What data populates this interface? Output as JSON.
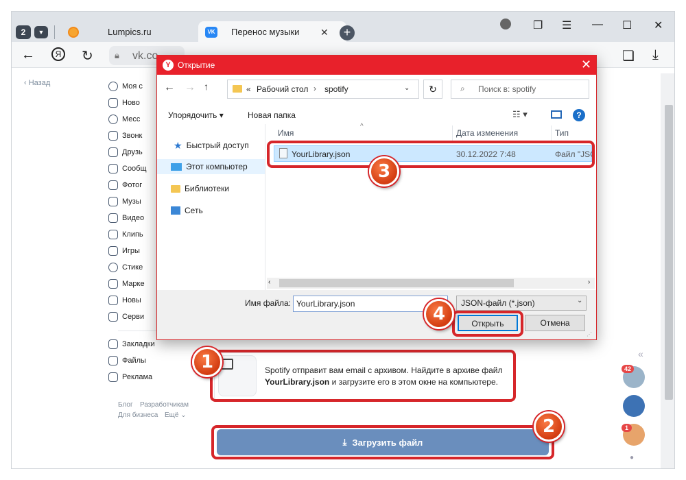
{
  "browser": {
    "tab_count": "2",
    "tabs": [
      {
        "title": "Lumpics.ru"
      },
      {
        "title": "Перенос музыки",
        "close": "✕"
      }
    ],
    "new_tab": "+",
    "window": {
      "minimize": "—",
      "maximize": "☐",
      "close": "✕"
    },
    "address": "vk.co",
    "toolbar_icons": [
      "back-icon",
      "yandex-icon",
      "reload-icon",
      "lock-icon",
      "collections-icon",
      "download-icon"
    ]
  },
  "vk": {
    "back_label": "Назад",
    "menu": [
      {
        "label": "Моя с"
      },
      {
        "label": "Ново"
      },
      {
        "label": "Месс"
      },
      {
        "label": "Звонк"
      },
      {
        "label": "Друзь"
      },
      {
        "label": "Сообщ"
      },
      {
        "label": "Фотог"
      },
      {
        "label": "Музы"
      },
      {
        "label": "Видео"
      },
      {
        "label": "Клипь"
      },
      {
        "label": "Игры"
      },
      {
        "label": "Стике"
      },
      {
        "label": "Марке"
      },
      {
        "label": "Новы"
      },
      {
        "label": "Серви"
      }
    ],
    "secondary": [
      {
        "label": "Закладки"
      },
      {
        "label": "Файлы"
      },
      {
        "label": "Реклама"
      }
    ],
    "footer": {
      "blog": "Блог",
      "dev": "Разработчикам",
      "business": "Для бизнеса",
      "more": "Ещё ⌄"
    },
    "email_text_1": "Spotify отправит вам email с архивом. Найдите в архиве файл",
    "email_text_bold": "YourLibrary.json",
    "email_text_2": " и загрузите его в этом окне на компьютере.",
    "upload_label": "Загрузить файл",
    "right_badges": {
      "first": "42",
      "second": "1"
    },
    "collapse": "«"
  },
  "dialog": {
    "title": "Открытие",
    "path": [
      "«",
      "Рабочий стол",
      "›",
      "spotify"
    ],
    "search_placeholder": "Поиск в: spotify",
    "organize": "Упорядочить ▾",
    "new_folder": "Новая папка",
    "nav": [
      {
        "label": "Быстрый доступ"
      },
      {
        "label": "Этот компьютер"
      },
      {
        "label": "Библиотеки"
      },
      {
        "label": "Сеть"
      }
    ],
    "columns": {
      "name": "Имя",
      "date": "Дата изменения",
      "type": "Тип"
    },
    "file": {
      "name": "YourLibrary.json",
      "date": "30.12.2022 7:48",
      "type": "Файл \"JSO"
    },
    "filename_label": "Имя файла:",
    "filename_value": "YourLibrary.json",
    "filetype": "JSON-файл (*.json)",
    "open": "Открыть",
    "cancel": "Отмена"
  },
  "callouts": [
    "1",
    "2",
    "3",
    "4"
  ],
  "colors": {
    "accent_red": "#d6262a",
    "vk_button": "#6a8ebd",
    "title_red": "#e8212b"
  }
}
